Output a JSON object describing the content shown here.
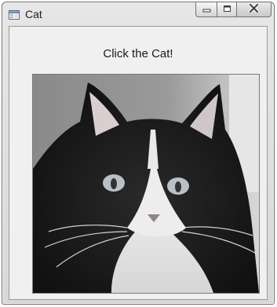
{
  "window": {
    "title": "Cat",
    "icon": "form-window-icon",
    "buttons": {
      "minimize": "minimize-icon",
      "maximize": "maximize-icon",
      "close": "close-icon"
    }
  },
  "form": {
    "label": "Click the Cat!",
    "picture": "cat-photo"
  }
}
